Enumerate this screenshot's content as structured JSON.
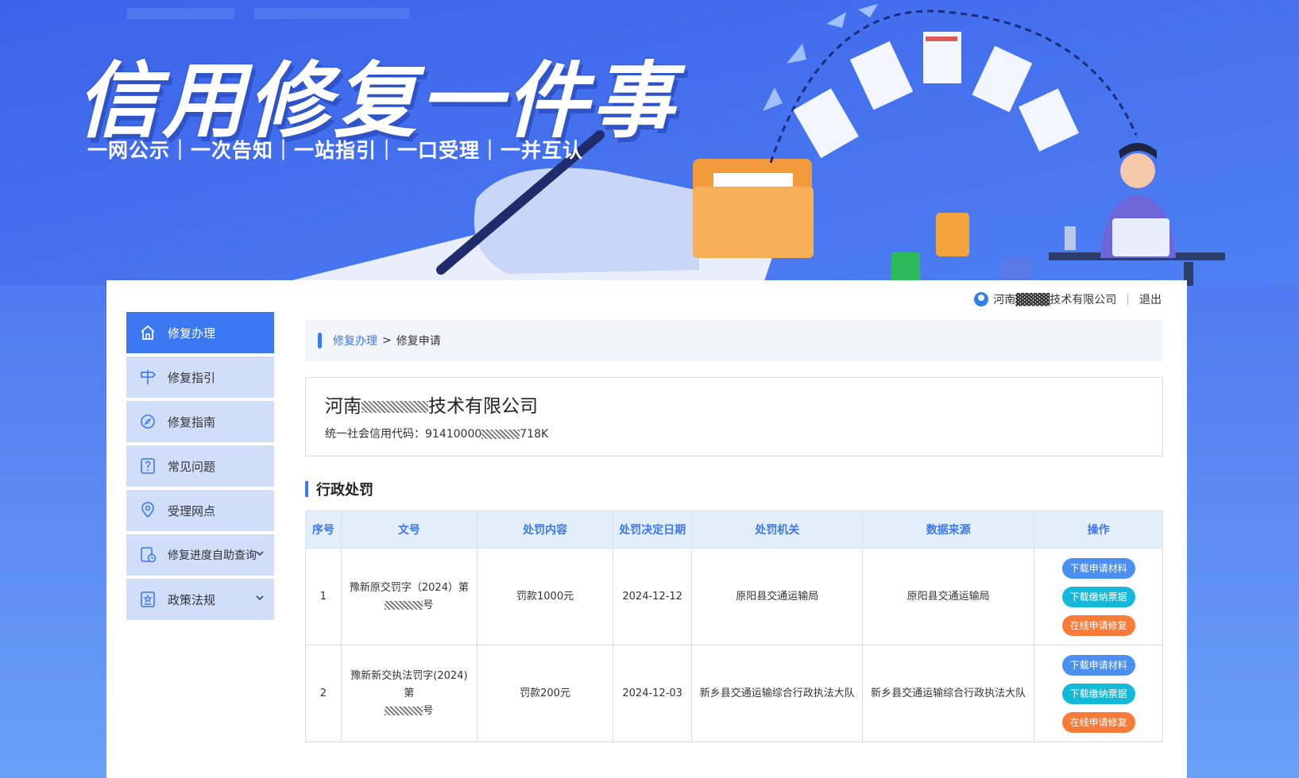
{
  "banner": {
    "title": "信用修复一件事",
    "subtitle": "一网公示｜一次告知｜一站指引｜一口受理｜一并互认"
  },
  "user": {
    "company_name": "河南▓▓▓▓技术有限公司",
    "logout": "退出"
  },
  "sidebar": {
    "items": [
      {
        "label": "修复办理",
        "icon": "home-icon"
      },
      {
        "label": "修复指引",
        "icon": "signpost-icon"
      },
      {
        "label": "修复指南",
        "icon": "compass-icon"
      },
      {
        "label": "常见问题",
        "icon": "question-doc-icon"
      },
      {
        "label": "受理网点",
        "icon": "location-pin-icon"
      },
      {
        "label": "修复进度自助查询",
        "icon": "progress-doc-icon"
      },
      {
        "label": "政策法规",
        "icon": "policy-doc-icon"
      }
    ]
  },
  "breadcrumb": {
    "parent": "修复办理",
    "separator": ">",
    "current": "修复申请"
  },
  "company": {
    "name_prefix": "河南",
    "name_suffix": "技术有限公司",
    "code_label": "统一社会信用代码：",
    "code_prefix": "91410000",
    "code_suffix": "718K"
  },
  "section": {
    "title": "行政处罚"
  },
  "table": {
    "headers": [
      "序号",
      "文号",
      "处罚内容",
      "处罚决定日期",
      "处罚机关",
      "数据来源",
      "操作"
    ],
    "rows": [
      {
        "index": "1",
        "doc_no_line1": "豫新原交罚字（2024）第",
        "doc_no_line2_suffix": "号",
        "content": "罚款1000元",
        "date": "2024-12-12",
        "authority": "原阳县交通运输局",
        "source": "原阳县交通运输局"
      },
      {
        "index": "2",
        "doc_no_line1": "豫新新交执法罚字(2024)第",
        "doc_no_line2_suffix": "号",
        "content": "罚款200元",
        "date": "2024-12-03",
        "authority": "新乡县交通运输综合行政执法大队",
        "source": "新乡县交通运输综合行政执法大队"
      }
    ],
    "actions": {
      "download_materials": "下载申请材料",
      "download_receipt": "下载缴纳票据",
      "apply_online": "在线申请修复"
    }
  },
  "colors": {
    "primary": "#3b78f2",
    "sidebar_bg": "#d0defa",
    "btn_blue": "#4a90f0",
    "btn_cyan": "#13b9d9",
    "btn_orange": "#f97b3a"
  }
}
